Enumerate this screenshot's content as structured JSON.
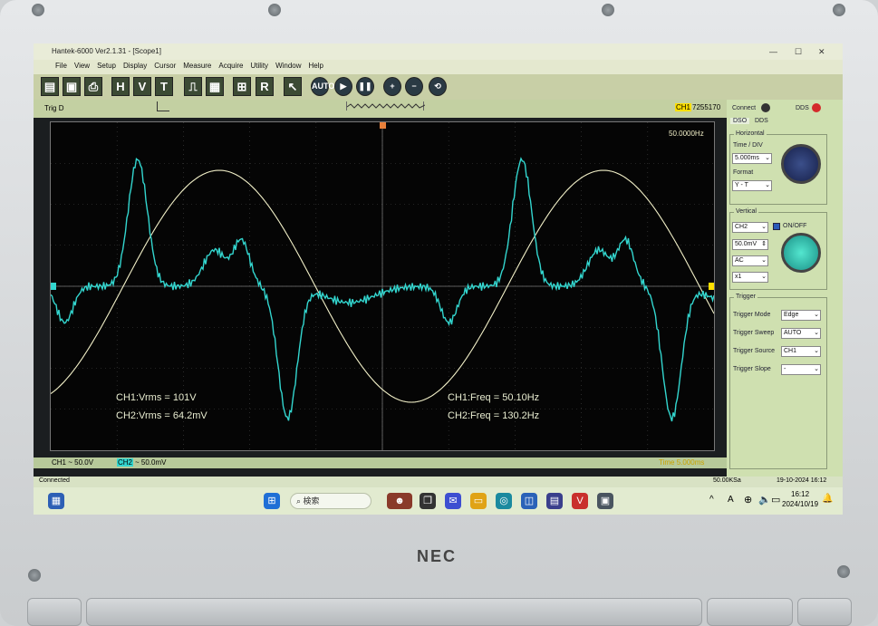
{
  "device": {
    "brand": "NEC"
  },
  "window": {
    "title": "Hantek-6000 Ver2.1.31 - [Scope1]",
    "menu": [
      "File",
      "View",
      "Setup",
      "Display",
      "Cursor",
      "Measure",
      "Acquire",
      "Utility",
      "Window",
      "Help"
    ]
  },
  "toolbar": {
    "buttons": [
      "H",
      "V",
      "T",
      "R"
    ],
    "auto_label": "AUTO"
  },
  "trigger_bar": {
    "label": "Trig D",
    "channel_tag": "CH1",
    "value": "7255170"
  },
  "scope": {
    "freq_readout": "50.0000Hz",
    "measurements": {
      "ch1_vrms": "CH1:Vrms = 101V",
      "ch2_vrms": "CH2:Vrms = 64.2mV",
      "ch1_freq": "CH1:Freq = 50.10Hz",
      "ch2_freq": "CH2:Freq = 130.2Hz"
    },
    "ch1_scale": "CH1 ~ 50.0V",
    "ch2_tag": "CH2",
    "ch2_scale": "~ 50.0mV",
    "time_readout": "Time 5.000ms",
    "colors": {
      "ch1": "#f2f0c8",
      "ch2": "#33d6cf",
      "grid": "#444444"
    }
  },
  "panel": {
    "connect_label": "Connect",
    "dds_label": "DDS",
    "tabs": [
      "DSO",
      "DDS"
    ],
    "horizontal": {
      "title": "Horizontal",
      "time_div_label": "Time / DIV",
      "time_div_value": "5.000ms",
      "format_label": "Format",
      "format_value": "Y - T"
    },
    "vertical": {
      "title": "Vertical",
      "channel": "CH2",
      "onoff_label": "ON/OFF",
      "volts": "50.0mV",
      "coupling": "AC",
      "probe": "x1"
    },
    "trigger": {
      "title": "Trigger",
      "rows": [
        {
          "label": "Trigger Mode",
          "value": "Edge"
        },
        {
          "label": "Trigger Sweep",
          "value": "AUTO"
        },
        {
          "label": "Trigger Source",
          "value": "CH1"
        },
        {
          "label": "Trigger Slope",
          "value": "-"
        }
      ]
    }
  },
  "status": {
    "left": "Connected",
    "sample_rate": "50.00KSa",
    "datetime": "19-10-2024  16:12"
  },
  "taskbar": {
    "search_placeholder": "検索",
    "time": "16:12",
    "date": "2024/10/19",
    "up_arrow": "^",
    "lang": "A"
  }
}
